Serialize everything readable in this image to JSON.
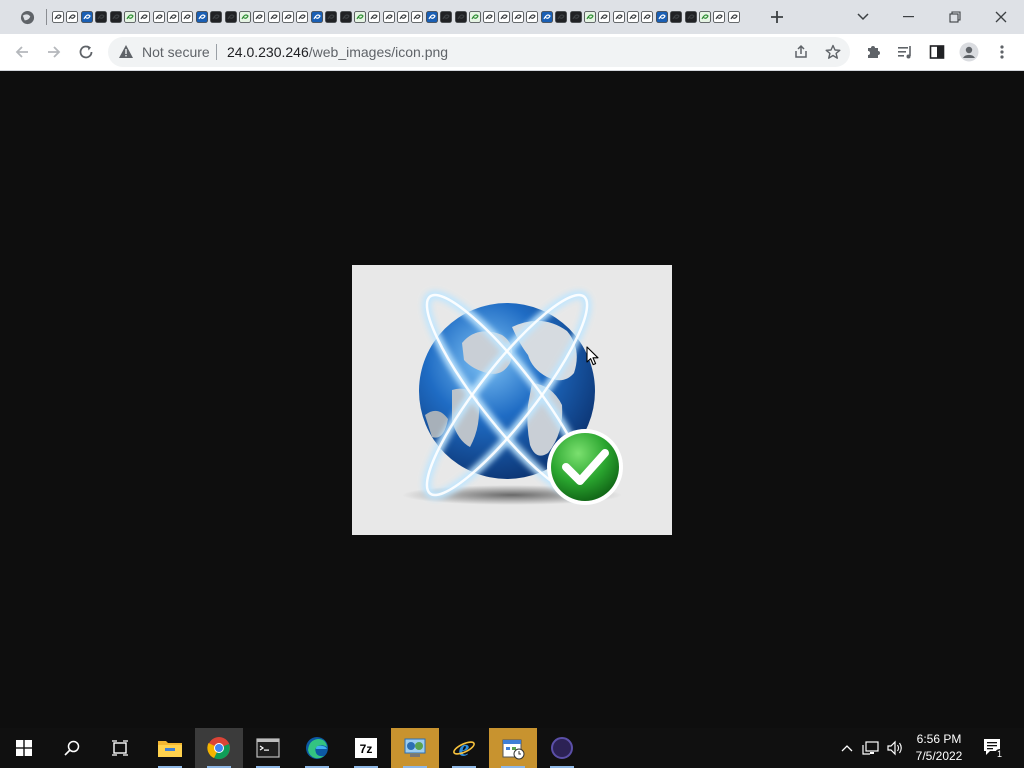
{
  "browser": {
    "tab_favicon_count": 48,
    "new_tab_label": "+",
    "omnibox": {
      "security_label": "Not secure",
      "url_host": "24.0.230.246",
      "url_path": "/web_images/icon.png"
    }
  },
  "page": {
    "image_description": "globe-checkmark-icon"
  },
  "taskbar": {
    "apps": [
      {
        "name": "file-explorer"
      },
      {
        "name": "chrome",
        "state": "active"
      },
      {
        "name": "command-prompt"
      },
      {
        "name": "edge"
      },
      {
        "name": "7zip"
      },
      {
        "name": "network-tool",
        "state": "highlight"
      },
      {
        "name": "internet-explorer"
      },
      {
        "name": "task-scheduler",
        "state": "highlight"
      },
      {
        "name": "eclipse"
      }
    ],
    "clock": {
      "time": "6:56 PM",
      "date": "7/5/2022"
    },
    "notification_count": "1"
  },
  "colors": {
    "tabstrip": "#dee1e6",
    "toolbar": "#ffffff",
    "omnibox": "#f1f3f4",
    "page_background": "#0e0e0e",
    "taskbar": "#101010",
    "chrome_icon_gray": "#5f6368",
    "globe_blue": "#1f6cc4",
    "check_green": "#2aa52f"
  }
}
